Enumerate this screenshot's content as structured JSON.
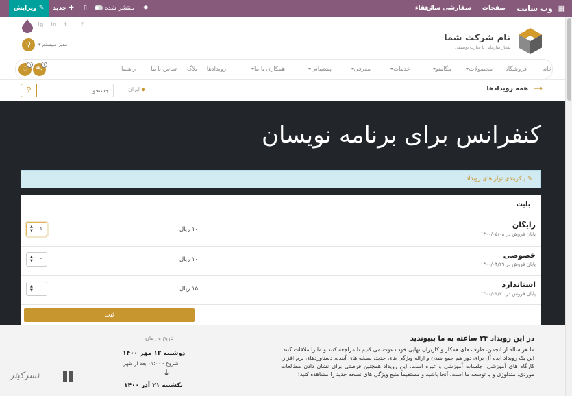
{
  "topbar": {
    "app": "وب سایت",
    "menu": [
      "صفحات",
      "سفارشی سازی",
      "ارتقاء"
    ],
    "published": "منتشر شده",
    "new": "جدید",
    "edit": "ویرایش"
  },
  "header": {
    "company_name": "نام شرکت شما",
    "company_tagline": "شعار سازمانی یا عبارت توصیفی",
    "user": "مدیر سیستم",
    "social": [
      "f",
      "t",
      "in",
      "ig"
    ],
    "cart_count": "1",
    "wishlist_count": "0"
  },
  "nav": {
    "items": [
      {
        "label": "خانه"
      },
      {
        "label": "فروشگاه"
      },
      {
        "label": "محصولات",
        "dropdown": true
      },
      {
        "label": "مگامنو",
        "dropdown": true
      },
      {
        "label": "خدمات",
        "dropdown": true
      },
      {
        "label": "معرفی",
        "dropdown": true
      },
      {
        "label": "پشتیبانی",
        "dropdown": true
      },
      {
        "label": "همکاری با ما",
        "dropdown": true
      },
      {
        "label": "رویدادها"
      },
      {
        "label": "بلاگ"
      },
      {
        "label": "تماس با ما"
      },
      {
        "label": "راهنما"
      }
    ]
  },
  "subbar": {
    "back": "همه رویدادها",
    "location": "ایران",
    "search_placeholder": "جستجو..."
  },
  "event": {
    "title": "کنفرانس برای برنامه نویسان",
    "snippet_label": "پیکربندی نوار های رویداد"
  },
  "tickets": {
    "heading": "بلیت",
    "rows": [
      {
        "name": "رایگان",
        "end": "پایان فروش در ۱۴۰۰/۰۵/۰۸",
        "price": "۱۰ ریال",
        "qty": "۱"
      },
      {
        "name": "خصوصی",
        "end": "پایان فروش در ۱۴۰۰/۰۴/۲۹",
        "price": "۱۰ ریال",
        "qty": "۰"
      },
      {
        "name": "استاندارد",
        "end": "پایان فروش در ۱۴۰۰/۰۴/۳۰",
        "price": "۱۵ ریال",
        "qty": "۰"
      }
    ],
    "register": "ثبت"
  },
  "about": {
    "title": "در این رویداد ۲۴ ساعته به ما بپیوندید",
    "text": "ما هر ساله از انجمن، طرف های همکار و کاربران نهایی خود دعوت می کنیم تا مراجعه کنند و ما را ملاقات کنند! این یک رویداد ایده آل برای دور هم جمع شدن و ارائه ویژگی های جدید، نسخه های آینده، دستاوردهای نرم افزار، کارگاه های آموزشی، جلسات آموزشی و غیره است. این رویداد همچنین فرصتی برای نشان دادن مطالعات موردی، متدلوژی و یا توسعه ما است. آنجا باشید و مستقیماً منبع ویژگی های نسخه جدید را مشاهده کنید!"
  },
  "datetime": {
    "heading": "تاریخ و زمان",
    "start_date": "دوشنبه ۱۲ مهر ۱۴۰۰",
    "start_time": "شروع - ۰۱:۰۰ بعد از ظهر",
    "end_date": "یکشنبه ۲۱ آذر ۱۴۰۰"
  },
  "watermark": "تسرکیتر",
  "colors": {
    "topbar": "#875a7b",
    "edit": "#00a09d",
    "accent": "#c8962f",
    "hero": "#22252a",
    "snippet": "#d2ebf3"
  }
}
